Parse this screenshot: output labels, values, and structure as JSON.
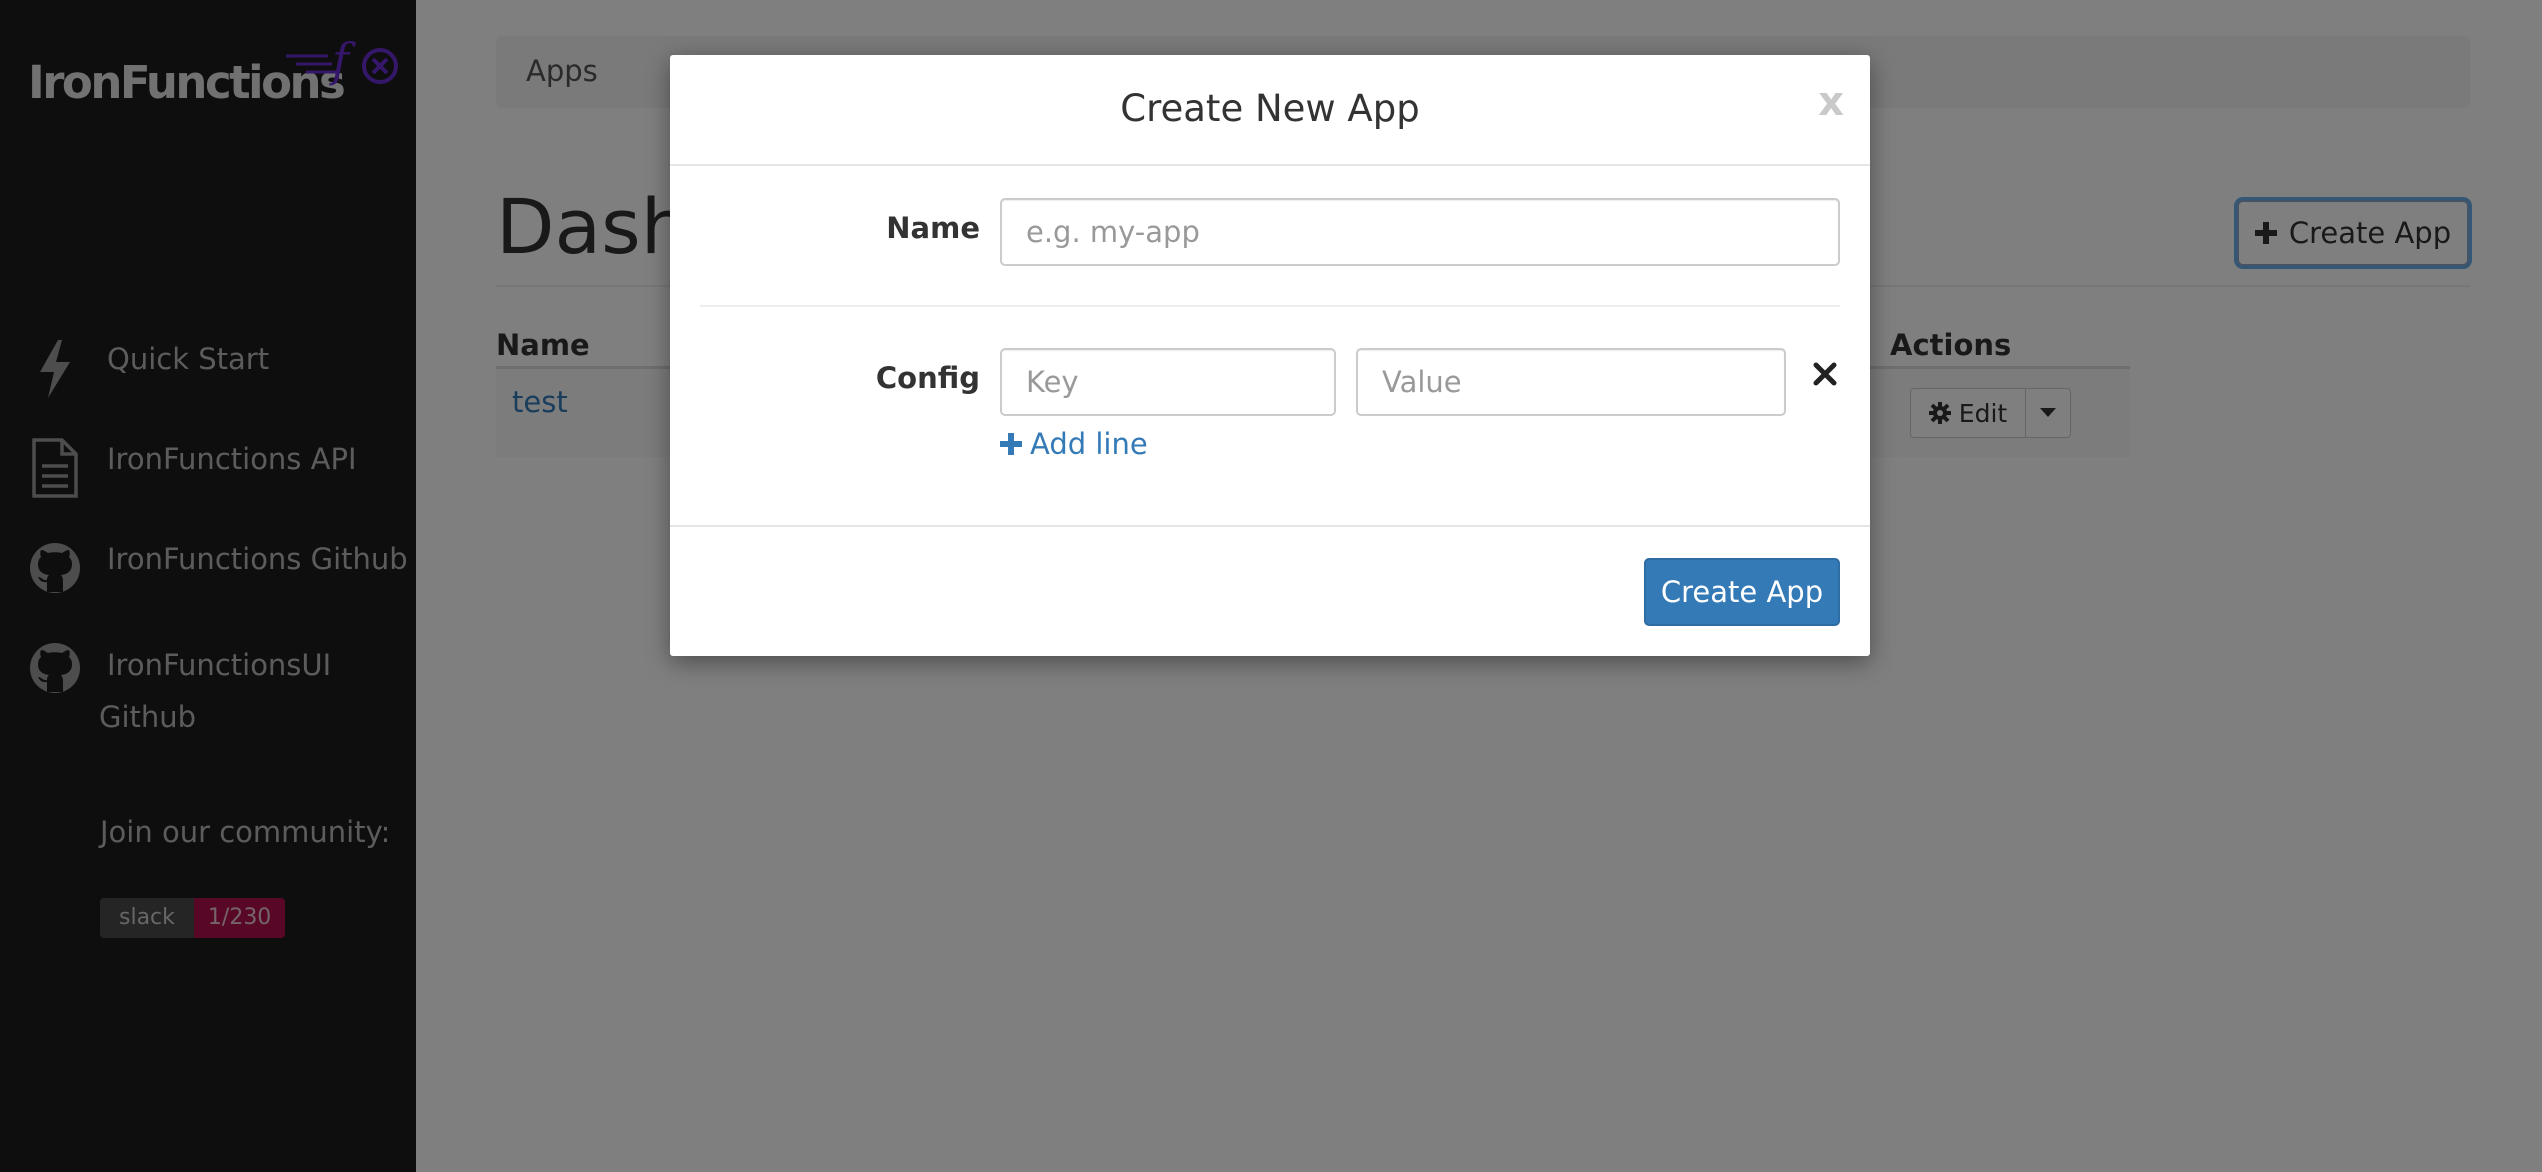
{
  "sidebar": {
    "logo_text": "IronFunctions",
    "logo_mark": "f(x)",
    "nav": [
      {
        "label": "Quick Start",
        "icon": "bolt-icon"
      },
      {
        "label": "IronFunctions API",
        "icon": "document-icon"
      },
      {
        "label": "IronFunctions Github",
        "icon": "github-icon"
      },
      {
        "label_line1": "IronFunctionsUI",
        "label_line2": "Github",
        "icon": "github-icon"
      }
    ],
    "community_label": "Join our community:",
    "slack_badge": {
      "label": "slack",
      "count": "1/230"
    }
  },
  "main": {
    "breadcrumb": "Apps",
    "page_title": "Dashboard",
    "create_button": "Create App",
    "table": {
      "columns": [
        "Name",
        "Actions"
      ],
      "rows": [
        {
          "name": "test",
          "action_label": "Edit"
        }
      ]
    }
  },
  "modal": {
    "title": "Create New App",
    "close_label": "x",
    "name_label": "Name",
    "name_placeholder": "e.g. my-app",
    "config_label": "Config",
    "key_placeholder": "Key",
    "value_placeholder": "Value",
    "add_line_label": "Add line",
    "submit_label": "Create App"
  },
  "colors": {
    "sidebar_bg": "#1c1c1c",
    "brand_purple": "#6a2fd4",
    "primary_blue": "#337ab7",
    "slack_count_bg": "#b0104c"
  }
}
